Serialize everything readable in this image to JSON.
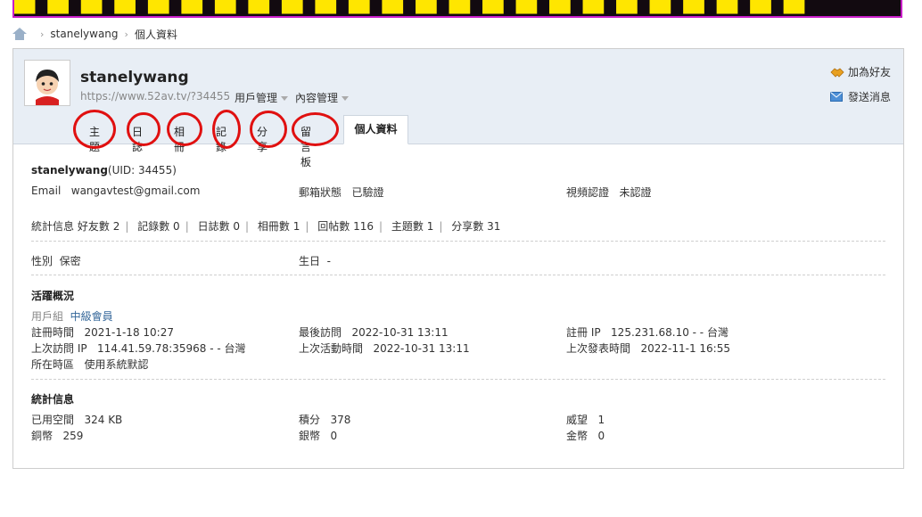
{
  "breadcrumb": {
    "user": "stanelywang",
    "current": "個人資料"
  },
  "header": {
    "username": "stanelywang",
    "url": "https://www.52av.tv/?34455",
    "menus": [
      "用戶管理",
      "內容管理"
    ],
    "actions": {
      "add_friend": "加為好友",
      "send_message": "發送消息"
    }
  },
  "tabs": [
    "主題",
    "日誌",
    "相冊",
    "記錄",
    "分享",
    "留言板",
    "個人資料"
  ],
  "profile": {
    "name": "stanelywang",
    "uid": "(UID: 34455)",
    "email_label": "Email",
    "email": "wangavtest@gmail.com",
    "mail_status_label": "郵箱狀態",
    "mail_status": "已驗證",
    "video_label": "視頻認證",
    "video_status": "未認證",
    "stats_label": "統計信息",
    "stats": [
      {
        "label": "好友數",
        "value": "2"
      },
      {
        "label": "記錄數",
        "value": "0"
      },
      {
        "label": "日誌數",
        "value": "0"
      },
      {
        "label": "相冊數",
        "value": "1"
      },
      {
        "label": "回帖數",
        "value": "116"
      },
      {
        "label": "主題數",
        "value": "1"
      },
      {
        "label": "分享數",
        "value": "31"
      }
    ],
    "gender_label": "性別",
    "gender": "保密",
    "birthday_label": "生日",
    "birthday": "-"
  },
  "activity": {
    "title": "活躍概況",
    "group_label": "用戶組",
    "group": "中級會員",
    "reg_time_label": "註冊時間",
    "reg_time": "2021-1-18 10:27",
    "last_visit_label": "最後訪問",
    "last_visit": "2022-10-31 13:11",
    "reg_ip_label": "註冊 IP",
    "reg_ip": "125.231.68.10 - - 台灣",
    "last_ip_label": "上次訪問 IP",
    "last_ip": "114.41.59.78:35968 - - 台灣",
    "last_active_label": "上次活動時間",
    "last_active": "2022-10-31 13:11",
    "last_post_label": "上次發表時間",
    "last_post": "2022-11-1 16:55",
    "tz_label": "所在時區",
    "tz": "使用系統默認"
  },
  "statistics": {
    "title": "統計信息",
    "space_label": "已用空間",
    "space": "324 KB",
    "points_label": "積分",
    "points": "378",
    "prestige_label": "威望",
    "prestige": "1",
    "copper_label": "銅幣",
    "copper": "259",
    "silver_label": "銀幣",
    "silver": "0",
    "gold_label": "金幣",
    "gold": "0"
  }
}
